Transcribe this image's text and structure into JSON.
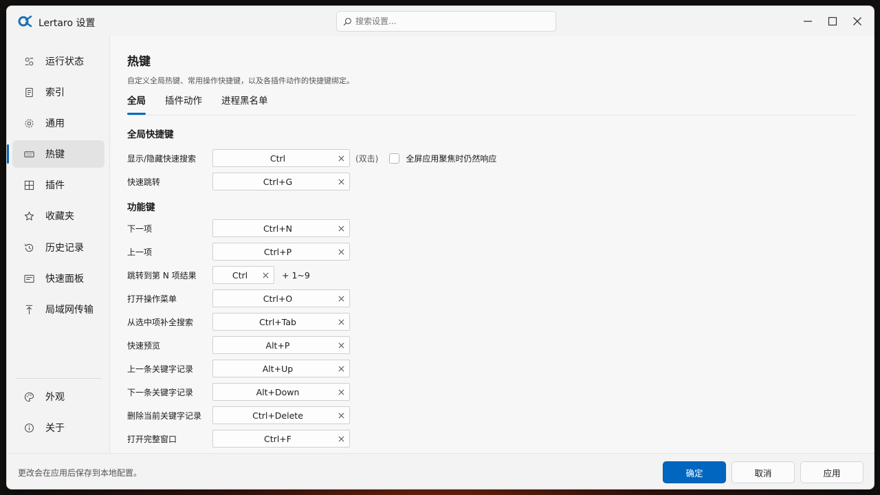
{
  "window": {
    "title": "Lertaro 设置",
    "search_placeholder": "搜索设置...",
    "accent": "#0067c0"
  },
  "sidebar": {
    "items": [
      {
        "label": "运行状态",
        "icon": "status-icon"
      },
      {
        "label": "索引",
        "icon": "index-icon"
      },
      {
        "label": "通用",
        "icon": "gear-icon"
      },
      {
        "label": "热键",
        "icon": "keyboard-icon",
        "active": true
      },
      {
        "label": "插件",
        "icon": "plugin-icon"
      },
      {
        "label": "收藏夹",
        "icon": "star-icon"
      },
      {
        "label": "历史记录",
        "icon": "history-icon"
      },
      {
        "label": "快速面板",
        "icon": "panel-icon"
      },
      {
        "label": "局域网传输",
        "icon": "upload-icon"
      }
    ],
    "bottom_items": [
      {
        "label": "外观",
        "icon": "palette-icon"
      },
      {
        "label": "关于",
        "icon": "info-icon"
      }
    ]
  },
  "main": {
    "title": "热键",
    "description": "自定义全局热键、常用操作快捷键，以及各插件动作的快捷键绑定。",
    "tabs": [
      {
        "label": "全局",
        "active": true
      },
      {
        "label": "插件动作"
      },
      {
        "label": "进程黑名单"
      }
    ],
    "global_section": {
      "title": "全局快捷键",
      "rows": [
        {
          "label": "显示/隐藏快速搜索",
          "value": "Ctrl",
          "note": "(双击)",
          "checkbox_label": "全屏应用聚焦时仍然响应",
          "checked": false
        },
        {
          "label": "快速跳转",
          "value": "Ctrl+G"
        }
      ]
    },
    "function_section": {
      "title": "功能键",
      "rows": [
        {
          "label": "下一项",
          "value": "Ctrl+N"
        },
        {
          "label": "上一项",
          "value": "Ctrl+P"
        },
        {
          "label": "跳转到第 N 项结果",
          "value": "Ctrl",
          "suffix": "+ 1~9"
        },
        {
          "label": "打开操作菜单",
          "value": "Ctrl+O"
        },
        {
          "label": "从选中项补全搜索",
          "value": "Ctrl+Tab"
        },
        {
          "label": "快速预览",
          "value": "Alt+P"
        },
        {
          "label": "上一条关键字记录",
          "value": "Alt+Up"
        },
        {
          "label": "下一条关键字记录",
          "value": "Alt+Down"
        },
        {
          "label": "删除当前关键字记录",
          "value": "Ctrl+Delete"
        },
        {
          "label": "打开完整窗口",
          "value": "Ctrl+F"
        }
      ]
    }
  },
  "footer": {
    "note": "更改会在应用后保存到本地配置。",
    "ok": "确定",
    "cancel": "取消",
    "apply": "应用"
  }
}
